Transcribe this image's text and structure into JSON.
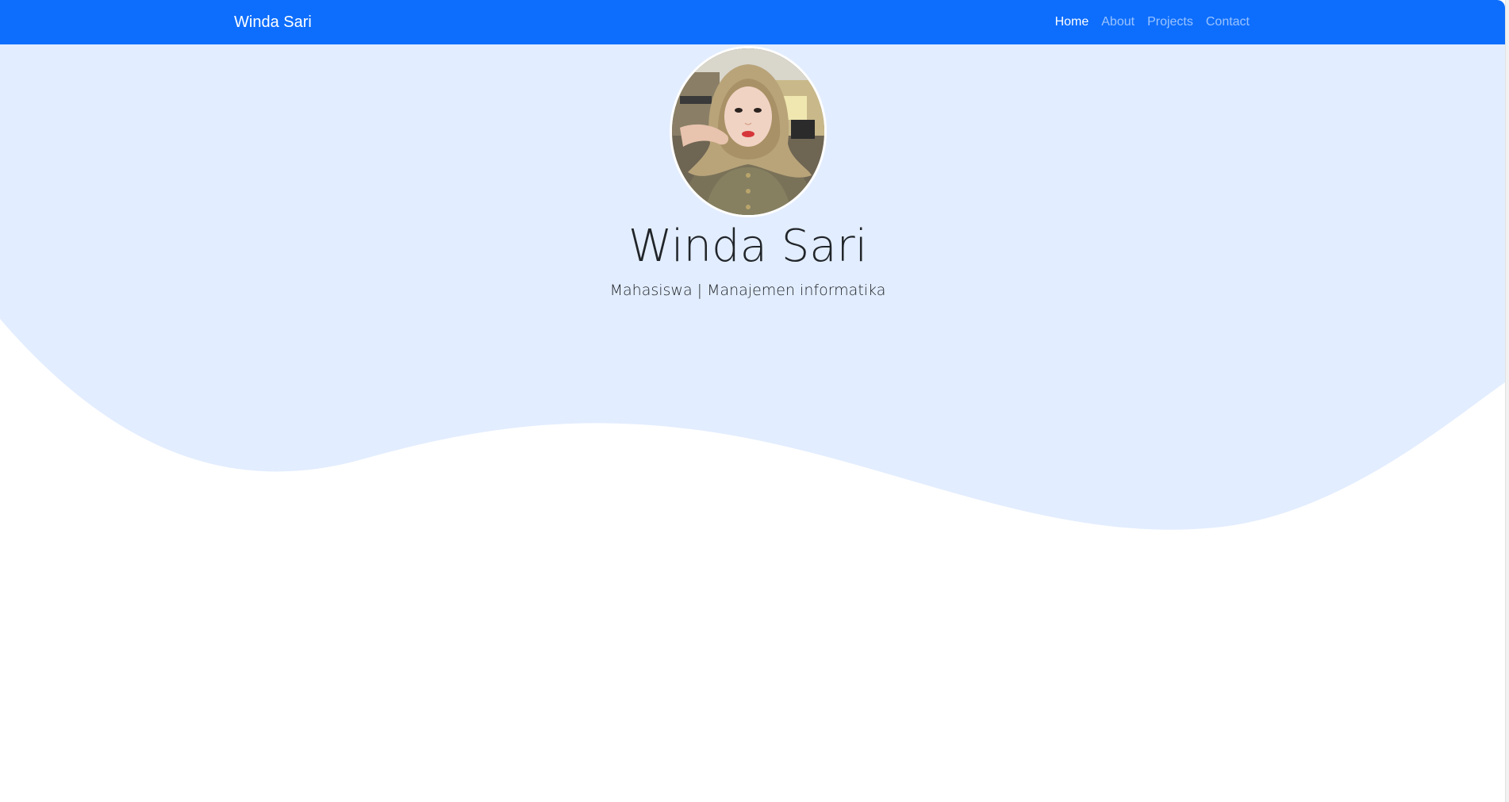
{
  "navbar": {
    "brand": "Winda Sari",
    "items": [
      {
        "label": "Home",
        "active": true
      },
      {
        "label": "About",
        "active": false
      },
      {
        "label": "Projects",
        "active": false
      },
      {
        "label": "Contact",
        "active": false
      }
    ],
    "color": "#0d6efd"
  },
  "hero": {
    "title": "Winda Sari",
    "subtitle": "Mahasiswa | Manajemen informatika",
    "background_color": "#e2edff",
    "avatar_image": "profile-photo"
  }
}
